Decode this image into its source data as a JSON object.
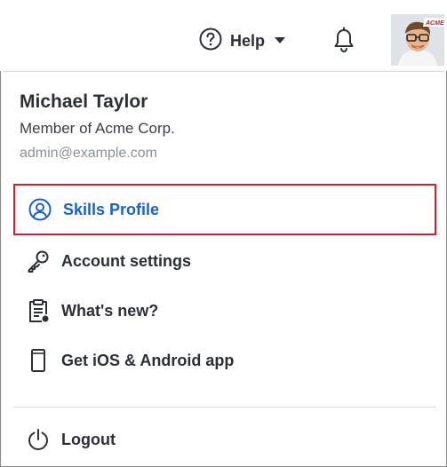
{
  "header": {
    "help_label": "Help",
    "help_icon": "question-circle-icon",
    "bell_icon": "bell-icon",
    "avatar_badge": "ACME"
  },
  "user": {
    "name": "Michael Taylor",
    "org": "Member of Acme Corp.",
    "email": "admin@example.com"
  },
  "menu": {
    "items": [
      {
        "label": "Skills Profile",
        "icon": "user-circle-icon"
      },
      {
        "label": "Account settings",
        "icon": "key-icon"
      },
      {
        "label": "What's new?",
        "icon": "clipboard-icon"
      },
      {
        "label": "Get iOS & Android app",
        "icon": "mobile-phone-icon"
      }
    ],
    "logout_label": "Logout",
    "logout_icon": "power-icon"
  },
  "colors": {
    "active_text": "#1a62c9",
    "active_border": "#d0202e",
    "text": "#2b2f36",
    "muted": "#8a9098"
  }
}
